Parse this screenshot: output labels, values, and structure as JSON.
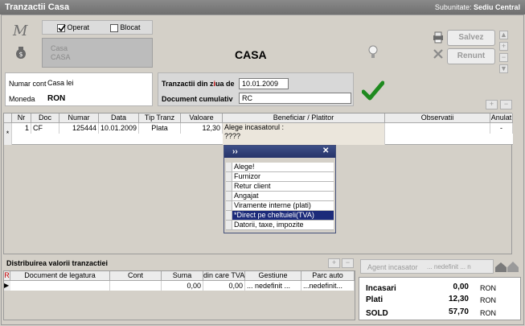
{
  "window": {
    "title": "Tranzactii Casa",
    "subunit_label": "Subunitate:",
    "subunit_value": "Sediu Central"
  },
  "header": {
    "logo_letter": "M",
    "operat_label": "Operat",
    "operat_checked": true,
    "blocat_label": "Blocat",
    "blocat_checked": false,
    "account_line1": "Casa",
    "account_line2": "CASA",
    "title": "CASA",
    "save_label": "Salvez",
    "cancel_label": "Renunt"
  },
  "form": {
    "cont_label": "Numar cont",
    "cont_value": "Casa lei",
    "moneda_label": "Moneda",
    "moneda_value": "RON",
    "date_label_pre": "Tranzactii din z",
    "date_label_hot": "i",
    "date_label_post": "ua de",
    "date_value": "10.01.2009",
    "doc_label": "Document cumulativ",
    "doc_value": "RC"
  },
  "grid": {
    "columns": [
      "Nr",
      "Doc",
      "Numar",
      "Data",
      "Tip Tranz",
      "Valoare",
      "Beneficiar  / Platitor",
      "Observatii",
      "Anulat"
    ],
    "rows": [
      {
        "marker": "*",
        "nr": "1",
        "doc": "CF",
        "numar": "125444",
        "data": "10.01.2009",
        "tip": "Plata",
        "valoare": "12,30",
        "beneficiar1": "Alege incasatorul :",
        "beneficiar2": "????",
        "observatii": "",
        "anulat": "-"
      }
    ]
  },
  "popup": {
    "header": "››",
    "close": "✕",
    "options": [
      "Alege!",
      "Furnizor",
      "Retur client",
      "Angajat",
      "Viramente interne (plati)",
      "*Direct pe cheltuieli(TVA)",
      "Datorii, taxe, impozite"
    ],
    "selected_index": 5
  },
  "distrib": {
    "title": "Distribuirea valorii tranzactiei",
    "columns": [
      "Document de legatura",
      "Cont",
      "Suma",
      "din care TVA",
      "Gestiune",
      "Parc auto"
    ],
    "row": {
      "doc": "",
      "cont": "",
      "suma": "0,00",
      "tva": "0,00",
      "gestiune": "... nedefinit ...",
      "parc": "...nedefinit..."
    }
  },
  "agent": {
    "label": "Agent incasator",
    "value": "... nedefinit ... n"
  },
  "totals": {
    "incasari_label": "Incasari",
    "incasari_value": "0,00",
    "plati_label": "Plati",
    "plati_value": "12,30",
    "sold_label": "SOLD",
    "sold_value": "57,70",
    "currency": "RON"
  }
}
